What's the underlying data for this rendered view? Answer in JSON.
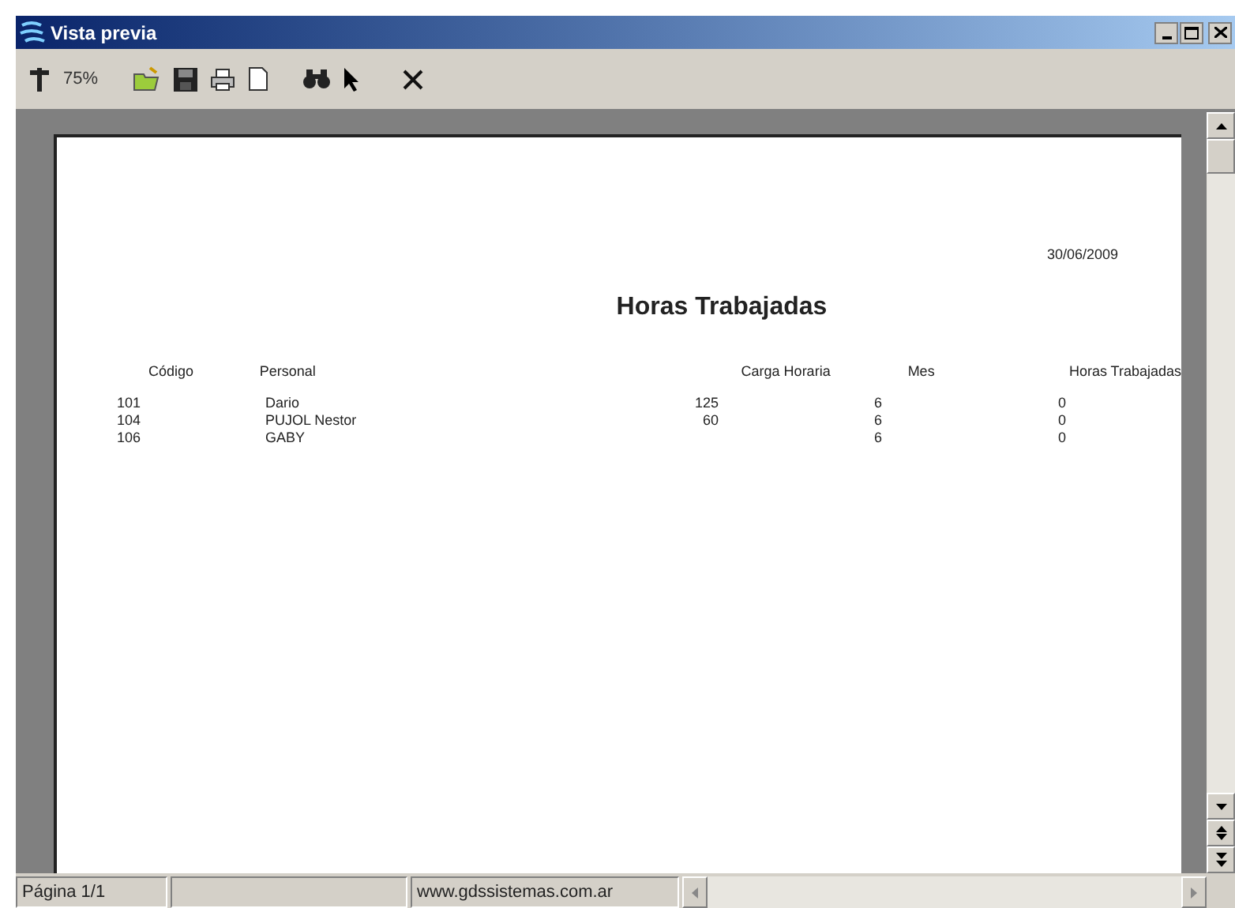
{
  "window": {
    "title": "Vista previa"
  },
  "toolbar": {
    "zoom": "75%"
  },
  "report": {
    "date": "30/06/2009",
    "title": "Horas Trabajadas",
    "columns": [
      "Código",
      "Personal",
      "Carga Horaria",
      "Mes",
      "Horas Trabajadas"
    ],
    "rows": [
      {
        "code": "101",
        "name": "Dario",
        "load": "125",
        "month": "6",
        "hours": "0"
      },
      {
        "code": "104",
        "name": "PUJOL Nestor",
        "load": "60",
        "month": "6",
        "hours": "0"
      },
      {
        "code": "106",
        "name": "GABY",
        "month": "6",
        "hours": "0"
      }
    ]
  },
  "status_bar": {
    "page": "Página 1/1",
    "url": "www.gdssistemas.com.ar"
  }
}
